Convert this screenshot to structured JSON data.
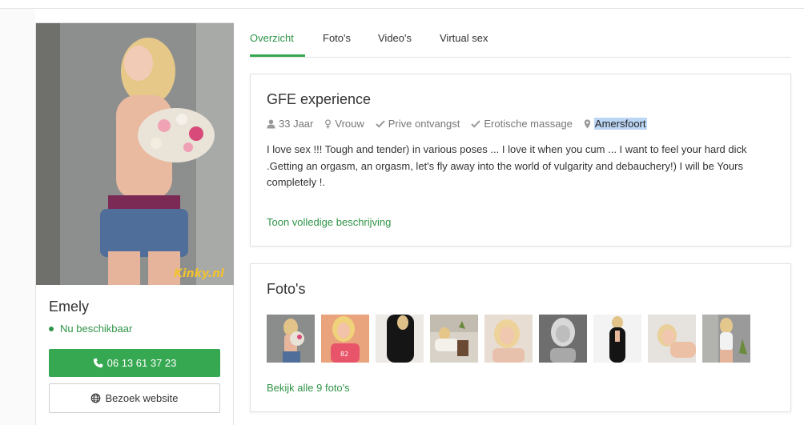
{
  "tabs": [
    {
      "label": "Overzicht",
      "active": true
    },
    {
      "label": "Foto's",
      "active": false
    },
    {
      "label": "Video's",
      "active": false
    },
    {
      "label": "Virtual sex",
      "active": false
    }
  ],
  "profile": {
    "name": "Emely",
    "status": "Nu beschikbaar",
    "phone": "06 13 61 37 23",
    "website_label": "Bezoek website",
    "watermark": "Kinky.nl"
  },
  "overview": {
    "title": "GFE experience",
    "meta": {
      "age": "33 Jaar",
      "gender": "Vrouw",
      "service1": "Prive ontvangst",
      "service2": "Erotische massage",
      "location": "Amersfoort"
    },
    "description": "I love sex !!!  Tough and tender) in various poses ... I love it when you cum ... I want to feel your hard dick .Getting an orgasm, an orgasm, let's fly away into the world of vulgarity and debauchery!) I will be Yours completely !.",
    "more_link": "Toon volledige beschrijving"
  },
  "photos": {
    "title": "Foto's",
    "view_all_link": "Bekijk alle 9 foto's",
    "thumb_count": 9
  },
  "colors": {
    "accent_green": "#37a852",
    "link_green": "#2f9447",
    "text": "#333333",
    "muted": "#777777"
  },
  "icons": {
    "phone": "phone-icon",
    "website": "globe-icon",
    "age": "user-icon",
    "gender": "female-icon",
    "service": "check-icon",
    "location": "map-marker-icon"
  }
}
